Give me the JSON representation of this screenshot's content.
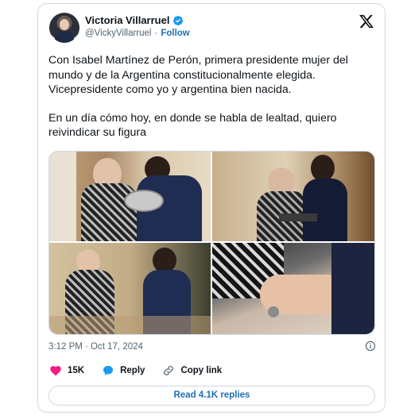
{
  "author": {
    "name": "Victoria Villarruel",
    "handle": "@VickyVillarruel",
    "separator": "·",
    "follow_label": "Follow"
  },
  "tweet": {
    "paragraph1": "Con Isabel Martínez de Perón, primera presidente mujer del mundo y de la Argentina constitucionalmente elegida. Vicepresidente como yo y argentina bien nacida.",
    "paragraph2": "En un día cómo hoy, en donde se habla de lealtad, quiero reivindicar su figura"
  },
  "timestamp": "3:12 PM · Oct 17, 2024",
  "actions": {
    "likes": "15K",
    "reply_label": "Reply",
    "copy_link_label": "Copy link"
  },
  "read_replies_label": "Read 4.1K replies",
  "colors": {
    "verified_blue": "#1d9bf0",
    "heart_pink": "#f91880",
    "reply_blue": "#1d9bf0",
    "link_blue": "#1d6fb8",
    "border": "#cfd9de"
  },
  "icons": [
    "verified-badge-icon",
    "x-logo-icon",
    "info-icon",
    "heart-icon",
    "reply-bubble-icon",
    "link-icon"
  ]
}
